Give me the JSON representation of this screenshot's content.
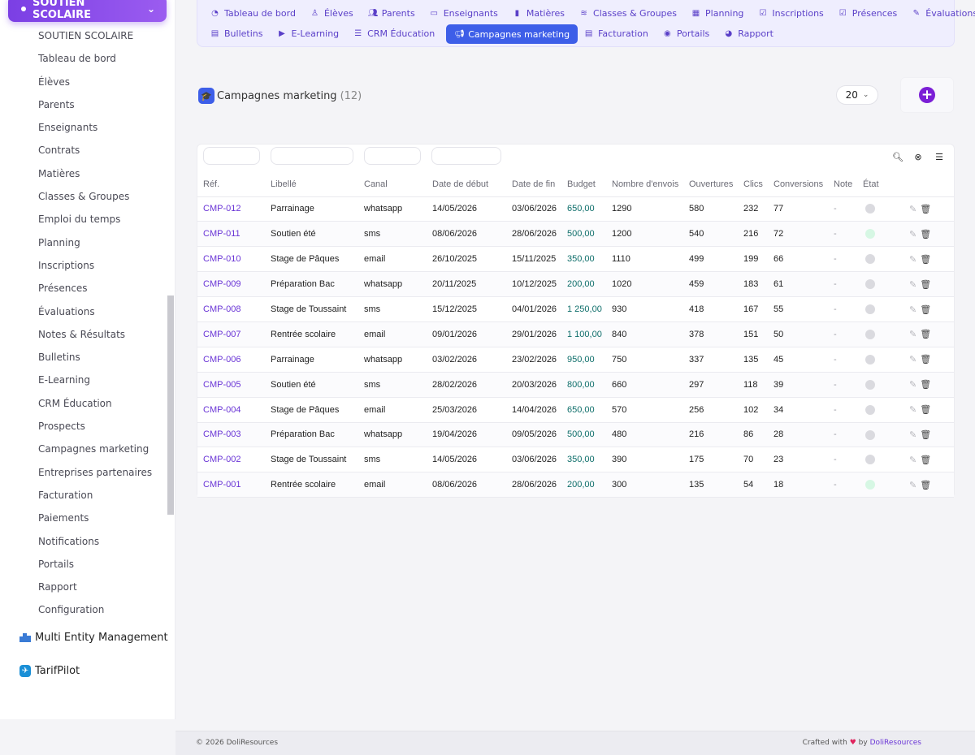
{
  "sidebar": {
    "module": "SOUTIEN SCOLAIRE",
    "items": [
      "SOUTIEN SCOLAIRE",
      "Tableau de bord",
      "Élèves",
      "Parents",
      "Enseignants",
      "Contrats",
      "Matières",
      "Classes & Groupes",
      "Emploi du temps",
      "Planning",
      "Inscriptions",
      "Présences",
      "Évaluations",
      "Notes & Résultats",
      "Bulletins",
      "E-Learning",
      "CRM Éducation",
      "Prospects",
      "Campagnes marketing",
      "Entreprises partenaires",
      "Facturation",
      "Paiements",
      "Notifications",
      "Portails",
      "Rapport",
      "Configuration"
    ],
    "extra_modules": [
      "Multi Entity Management",
      "TarifPilot"
    ]
  },
  "topnav": {
    "row1": [
      {
        "label": "Tableau de bord",
        "icon": "dashboard-icon"
      },
      {
        "label": "Élèves",
        "icon": "student-icon"
      },
      {
        "label": "Parents",
        "icon": "users-icon"
      },
      {
        "label": "Enseignants",
        "icon": "teacher-icon"
      },
      {
        "label": "Matières",
        "icon": "book-icon"
      },
      {
        "label": "Classes & Groupes",
        "icon": "layers-icon"
      },
      {
        "label": "Planning",
        "icon": "calendar-icon"
      },
      {
        "label": "Inscriptions",
        "icon": "clipboard-check-icon"
      },
      {
        "label": "Présences",
        "icon": "clipboard-check-icon"
      },
      {
        "label": "Évaluations",
        "icon": "pen-icon"
      }
    ],
    "row2": [
      {
        "label": "Bulletins",
        "icon": "file-icon"
      },
      {
        "label": "E-Learning",
        "icon": "video-icon"
      },
      {
        "label": "CRM Éducation",
        "icon": "list-icon"
      },
      {
        "label": "Campagnes marketing",
        "icon": "megaphone-icon",
        "active": true
      },
      {
        "label": "Facturation",
        "icon": "file-icon"
      },
      {
        "label": "Portails",
        "icon": "user-circle-icon"
      },
      {
        "label": "Rapport",
        "icon": "pie-chart-icon"
      }
    ]
  },
  "page": {
    "title": "Campagnes marketing",
    "count": "(12)",
    "page_size": "20"
  },
  "table": {
    "columns": [
      "Réf.",
      "Libellé",
      "Canal",
      "Date de début",
      "Date de fin",
      "Budget",
      "Nombre d'envois",
      "Ouvertures",
      "Clics",
      "Conversions",
      "Note",
      "État"
    ],
    "rows": [
      {
        "ref": "CMP-012",
        "libelle": "Parrainage",
        "canal": "whatsapp",
        "debut": "14/05/2026",
        "fin": "03/06/2026",
        "budget": "650,00",
        "envois": "1290",
        "ouvertures": "580",
        "clics": "232",
        "conversions": "77",
        "note": "-",
        "etat_active": false
      },
      {
        "ref": "CMP-011",
        "libelle": "Soutien été",
        "canal": "sms",
        "debut": "08/06/2026",
        "fin": "28/06/2026",
        "budget": "500,00",
        "envois": "1200",
        "ouvertures": "540",
        "clics": "216",
        "conversions": "72",
        "note": "-",
        "etat_active": true
      },
      {
        "ref": "CMP-010",
        "libelle": "Stage de Pâques",
        "canal": "email",
        "debut": "26/10/2025",
        "fin": "15/11/2025",
        "budget": "350,00",
        "envois": "1110",
        "ouvertures": "499",
        "clics": "199",
        "conversions": "66",
        "note": "-",
        "etat_active": false
      },
      {
        "ref": "CMP-009",
        "libelle": "Préparation Bac",
        "canal": "whatsapp",
        "debut": "20/11/2025",
        "fin": "10/12/2025",
        "budget": "200,00",
        "envois": "1020",
        "ouvertures": "459",
        "clics": "183",
        "conversions": "61",
        "note": "-",
        "etat_active": false
      },
      {
        "ref": "CMP-008",
        "libelle": "Stage de Toussaint",
        "canal": "sms",
        "debut": "15/12/2025",
        "fin": "04/01/2026",
        "budget": "1 250,00",
        "envois": "930",
        "ouvertures": "418",
        "clics": "167",
        "conversions": "55",
        "note": "-",
        "etat_active": false
      },
      {
        "ref": "CMP-007",
        "libelle": "Rentrée scolaire",
        "canal": "email",
        "debut": "09/01/2026",
        "fin": "29/01/2026",
        "budget": "1 100,00",
        "envois": "840",
        "ouvertures": "378",
        "clics": "151",
        "conversions": "50",
        "note": "-",
        "etat_active": false
      },
      {
        "ref": "CMP-006",
        "libelle": "Parrainage",
        "canal": "whatsapp",
        "debut": "03/02/2026",
        "fin": "23/02/2026",
        "budget": "950,00",
        "envois": "750",
        "ouvertures": "337",
        "clics": "135",
        "conversions": "45",
        "note": "-",
        "etat_active": false
      },
      {
        "ref": "CMP-005",
        "libelle": "Soutien été",
        "canal": "sms",
        "debut": "28/02/2026",
        "fin": "20/03/2026",
        "budget": "800,00",
        "envois": "660",
        "ouvertures": "297",
        "clics": "118",
        "conversions": "39",
        "note": "-",
        "etat_active": false
      },
      {
        "ref": "CMP-004",
        "libelle": "Stage de Pâques",
        "canal": "email",
        "debut": "25/03/2026",
        "fin": "14/04/2026",
        "budget": "650,00",
        "envois": "570",
        "ouvertures": "256",
        "clics": "102",
        "conversions": "34",
        "note": "-",
        "etat_active": false
      },
      {
        "ref": "CMP-003",
        "libelle": "Préparation Bac",
        "canal": "whatsapp",
        "debut": "19/04/2026",
        "fin": "09/05/2026",
        "budget": "500,00",
        "envois": "480",
        "ouvertures": "216",
        "clics": "86",
        "conversions": "28",
        "note": "-",
        "etat_active": false
      },
      {
        "ref": "CMP-002",
        "libelle": "Stage de Toussaint",
        "canal": "sms",
        "debut": "14/05/2026",
        "fin": "03/06/2026",
        "budget": "350,00",
        "envois": "390",
        "ouvertures": "175",
        "clics": "70",
        "conversions": "23",
        "note": "-",
        "etat_active": false
      },
      {
        "ref": "CMP-001",
        "libelle": "Rentrée scolaire",
        "canal": "email",
        "debut": "08/06/2026",
        "fin": "28/06/2026",
        "budget": "200,00",
        "envois": "300",
        "ouvertures": "135",
        "clics": "54",
        "conversions": "18",
        "note": "-",
        "etat_active": true
      }
    ]
  },
  "footer": {
    "copyright": "© 2026 DoliResources",
    "crafted": "Crafted with",
    "by": "by",
    "brand": "DoliResources"
  },
  "colors": {
    "accent": "#7b3fe4",
    "active_tab": "#3d5ee8",
    "ref_link": "#6a35d6",
    "budget": "#0e6e6a"
  }
}
